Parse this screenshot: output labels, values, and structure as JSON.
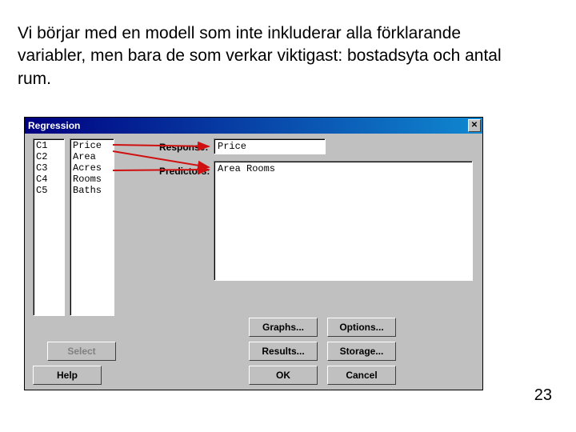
{
  "slide": {
    "paragraph": "Vi börjar med en modell som inte inkluderar alla förklarande variabler, men bara de som verkar viktigast: bostadsyta och antal rum.",
    "page_number": "23"
  },
  "dialog": {
    "title": "Regression",
    "close_glyph": "✕",
    "columns": {
      "ids": [
        "C1",
        "C2",
        "C3",
        "C4",
        "C5"
      ],
      "names": [
        "Price",
        "Area",
        "Acres",
        "Rooms",
        "Baths"
      ]
    },
    "labels": {
      "response": "Response:",
      "predictors": "Predictors:"
    },
    "fields": {
      "response_value": "Price",
      "predictors_value": "Area Rooms"
    },
    "buttons": {
      "graphs": "Graphs...",
      "options": "Options...",
      "select": "Select",
      "results": "Results...",
      "storage": "Storage...",
      "help": "Help",
      "ok": "OK",
      "cancel": "Cancel"
    }
  }
}
